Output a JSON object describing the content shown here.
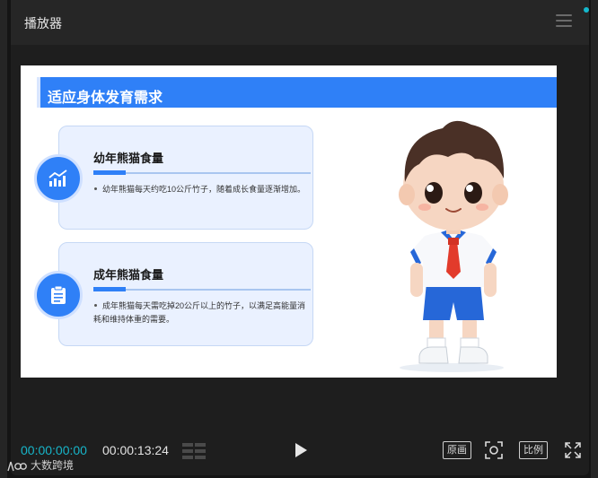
{
  "window": {
    "title": "播放器",
    "menu_icon": "hamburger-menu-icon",
    "notification_color": "#14b8cc"
  },
  "slide": {
    "header": "适应身体发育需求",
    "accent_color": "#2f80f7",
    "cards": [
      {
        "icon": "chart-icon",
        "title": "幼年熊猫食量",
        "text": "幼年熊猫每天约吃10公斤竹子，随着成长食量逐渐增加。"
      },
      {
        "icon": "clipboard-icon",
        "title": "成年熊猫食量",
        "text": "成年熊猫每天需吃掉20公斤以上的竹子，以满足高能量消耗和维持体重的需要。"
      }
    ],
    "illustration": "cartoon-boy-in-school-uniform"
  },
  "controls": {
    "current_time": "00:00:00:00",
    "total_time": "00:00:13:24",
    "original_label": "原画",
    "ratio_label": "比例",
    "timecode_color": "#17b5c9"
  },
  "brand": {
    "name": "大数跨境"
  }
}
